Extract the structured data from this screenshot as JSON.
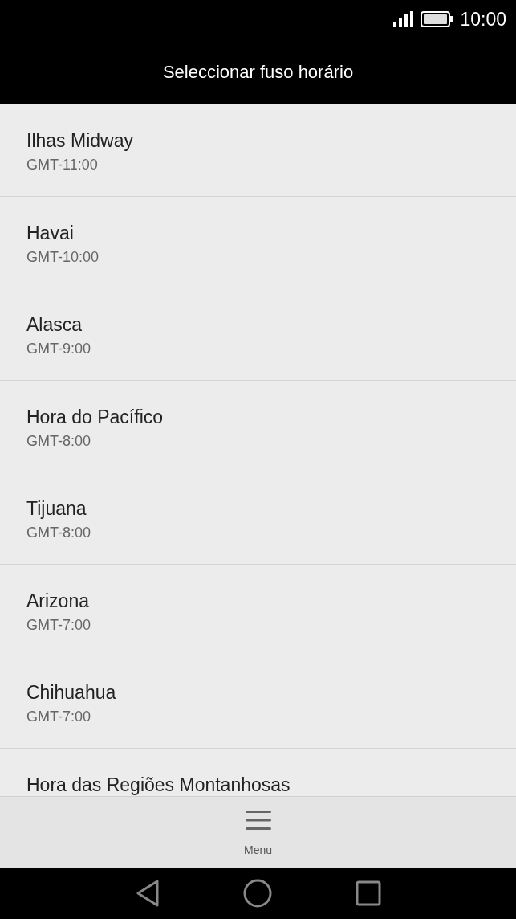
{
  "status_bar": {
    "time": "10:00"
  },
  "header": {
    "title": "Seleccionar fuso horário"
  },
  "timezones": [
    {
      "name": "Ilhas Midway",
      "offset": "GMT-11:00"
    },
    {
      "name": "Havai",
      "offset": "GMT-10:00"
    },
    {
      "name": "Alasca",
      "offset": "GMT-9:00"
    },
    {
      "name": "Hora do Pacífico",
      "offset": "GMT-8:00"
    },
    {
      "name": "Tijuana",
      "offset": "GMT-8:00"
    },
    {
      "name": "Arizona",
      "offset": "GMT-7:00"
    },
    {
      "name": "Chihuahua",
      "offset": "GMT-7:00"
    },
    {
      "name": "Hora das Regiões Montanhosas"
    }
  ],
  "bottom_bar": {
    "menu_label": "Menu"
  }
}
